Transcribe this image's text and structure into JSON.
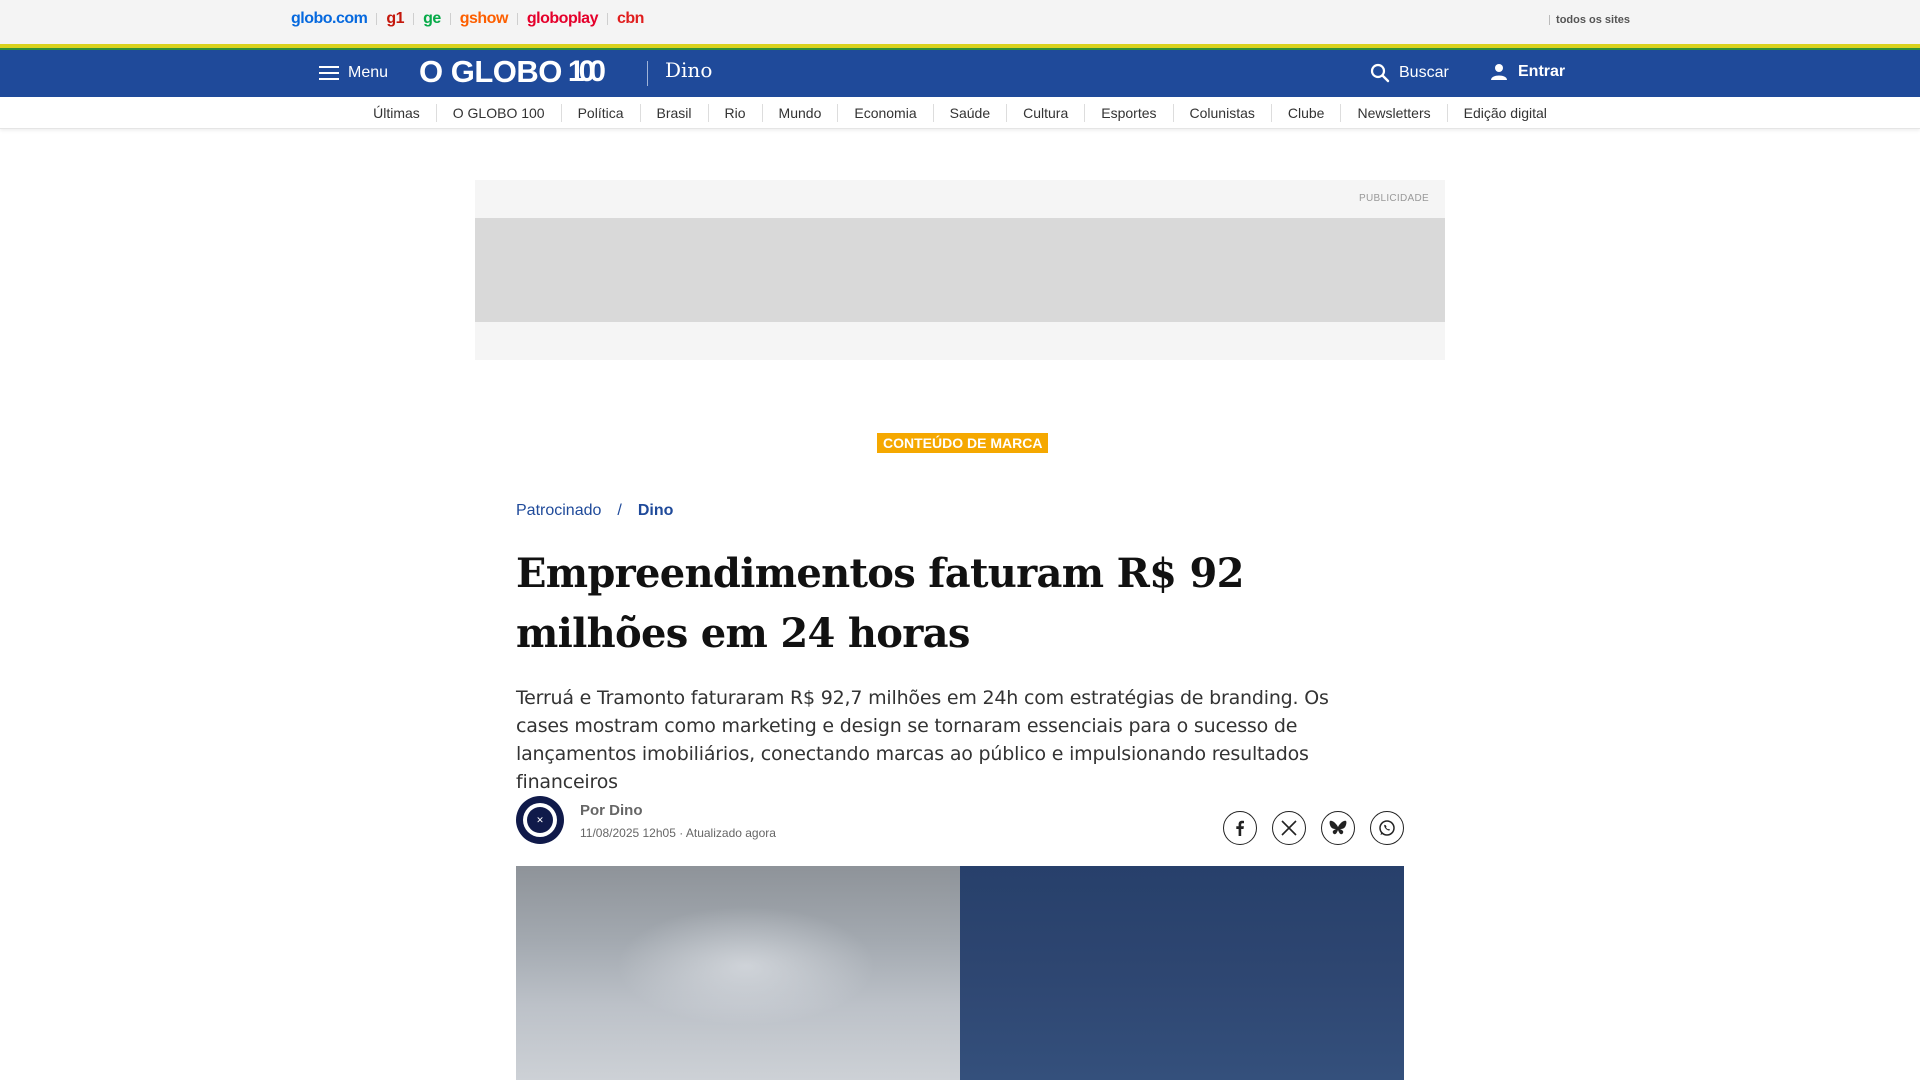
{
  "network": {
    "links": [
      {
        "label": "globo.com",
        "color": "#0669de"
      },
      {
        "label": "g1",
        "color": "#c4170c"
      },
      {
        "label": "ge",
        "color": "#06aa48"
      },
      {
        "label": "gshow",
        "color": "#fd5f00"
      },
      {
        "label": "globoplay",
        "color": "#e5002b"
      },
      {
        "label": "cbn",
        "color": "#e01e1e"
      }
    ],
    "all_sites_label": "todos os sites"
  },
  "header": {
    "menu_label": "Menu",
    "logo_text": "O GLOBO",
    "logo_hundred": "100",
    "section_name": "Dino",
    "search_label": "Buscar",
    "login_label": "Entrar",
    "background_color": "#1f4a9a"
  },
  "subnav": {
    "items": [
      "Últimas",
      "O GLOBO 100",
      "Política",
      "Brasil",
      "Rio",
      "Mundo",
      "Economia",
      "Saúde",
      "Cultura",
      "Esportes",
      "Colunistas",
      "Clube",
      "Newsletters",
      "Edição digital"
    ]
  },
  "ad": {
    "label": "PUBLICIDADE"
  },
  "article": {
    "badge": "CONTEÚDO DE MARCA",
    "badge_color": "#f5a800",
    "breadcrumb": {
      "parent": "Patrocinado",
      "separator": "/",
      "current": "Dino"
    },
    "title": "Empreendimentos faturam R$ 92 milhões em 24 horas",
    "subtitle": "Terruá e Tramonto faturaram R$ 92,7 milhões em 24h com estratégias de branding. Os cases mostram como marketing e design se tornaram essenciais para o sucesso de lançamentos imobiliários, conectando marcas ao público e impulsionando resultados financeiros",
    "author": "Por Dino",
    "date": "11/08/2025 12h05 · Atualizado agora",
    "share_icons": [
      "facebook-icon",
      "x-icon",
      "bluesky-icon",
      "whatsapp-icon"
    ]
  }
}
